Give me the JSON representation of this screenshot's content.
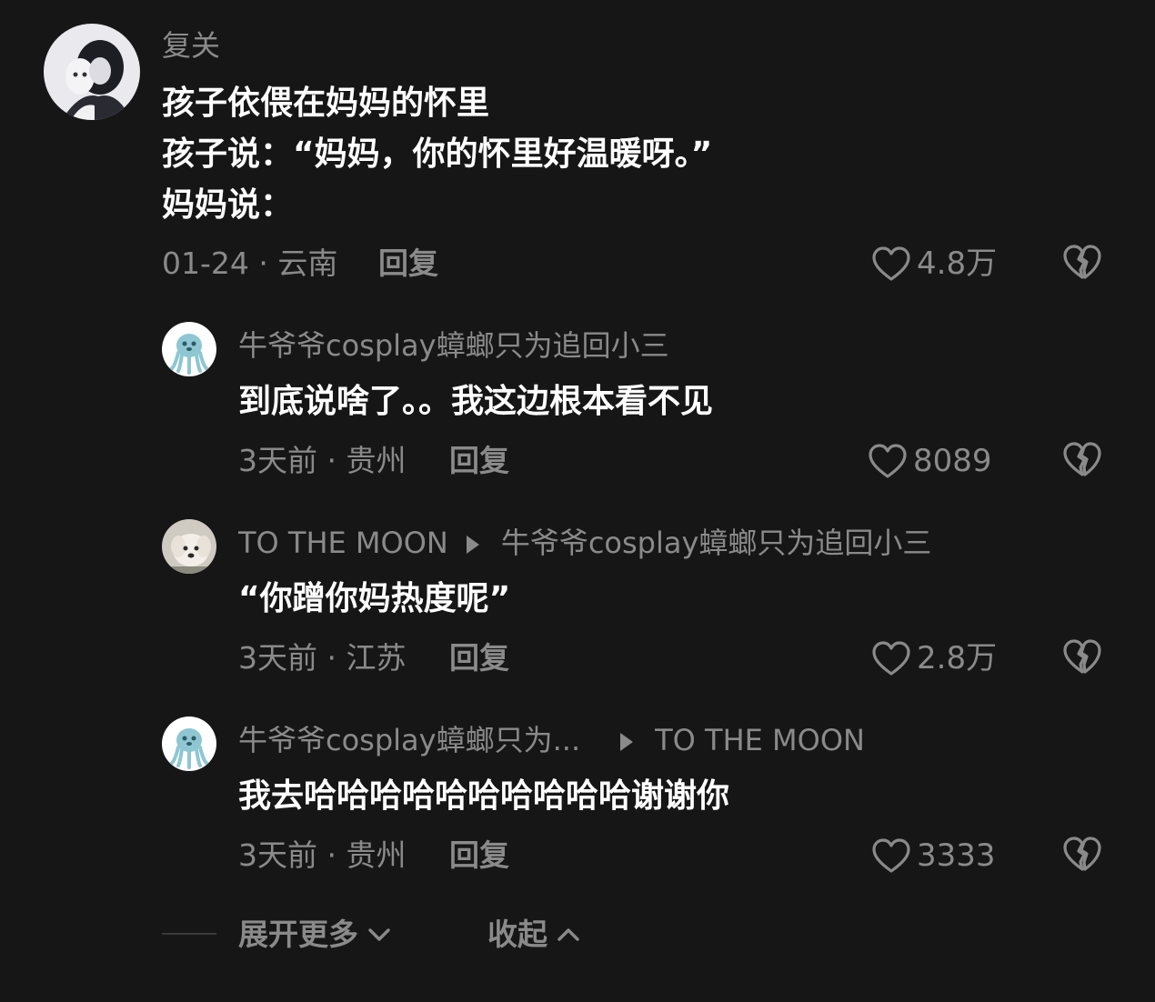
{
  "comments": [
    {
      "author": "复关",
      "lines": [
        "孩子依偎在妈妈的怀里",
        "孩子说：“妈妈，你的怀里好温暖呀。”",
        "妈妈说："
      ],
      "meta": "01-24 · 云南",
      "reply_label": "回复",
      "likes": "4.8万"
    },
    {
      "author": "牛爷爷cosplay蟑螂只为追回小三",
      "text": "到底说啥了。。我这边根本看不见",
      "meta": "3天前 · 贵州",
      "reply_label": "回复",
      "likes": "8089"
    },
    {
      "author": "TO THE MOON",
      "reply_to": "牛爷爷cosplay蟑螂只为追回小三",
      "text": "“你蹭你妈热度呢”",
      "meta": "3天前 · 江苏",
      "reply_label": "回复",
      "likes": "2.8万"
    },
    {
      "author": "牛爷爷cosplay蟑螂只为...",
      "reply_to": "TO THE MOON",
      "text": "我去哈哈哈哈哈哈哈哈哈哈谢谢你",
      "meta": "3天前 · 贵州",
      "reply_label": "回复",
      "likes": "3333"
    }
  ],
  "footer": {
    "expand_label": "展开更多",
    "collapse_label": "收起"
  },
  "icons": {
    "like": "heart-outline-icon",
    "dislike": "broken-heart-icon",
    "reply_arrow": "triangle-right-icon",
    "expand": "chevron-down-icon",
    "collapse": "chevron-up-icon"
  },
  "colors": {
    "background": "#161616",
    "primary_text": "#ffffff",
    "secondary_text": "#8a8a8a"
  }
}
